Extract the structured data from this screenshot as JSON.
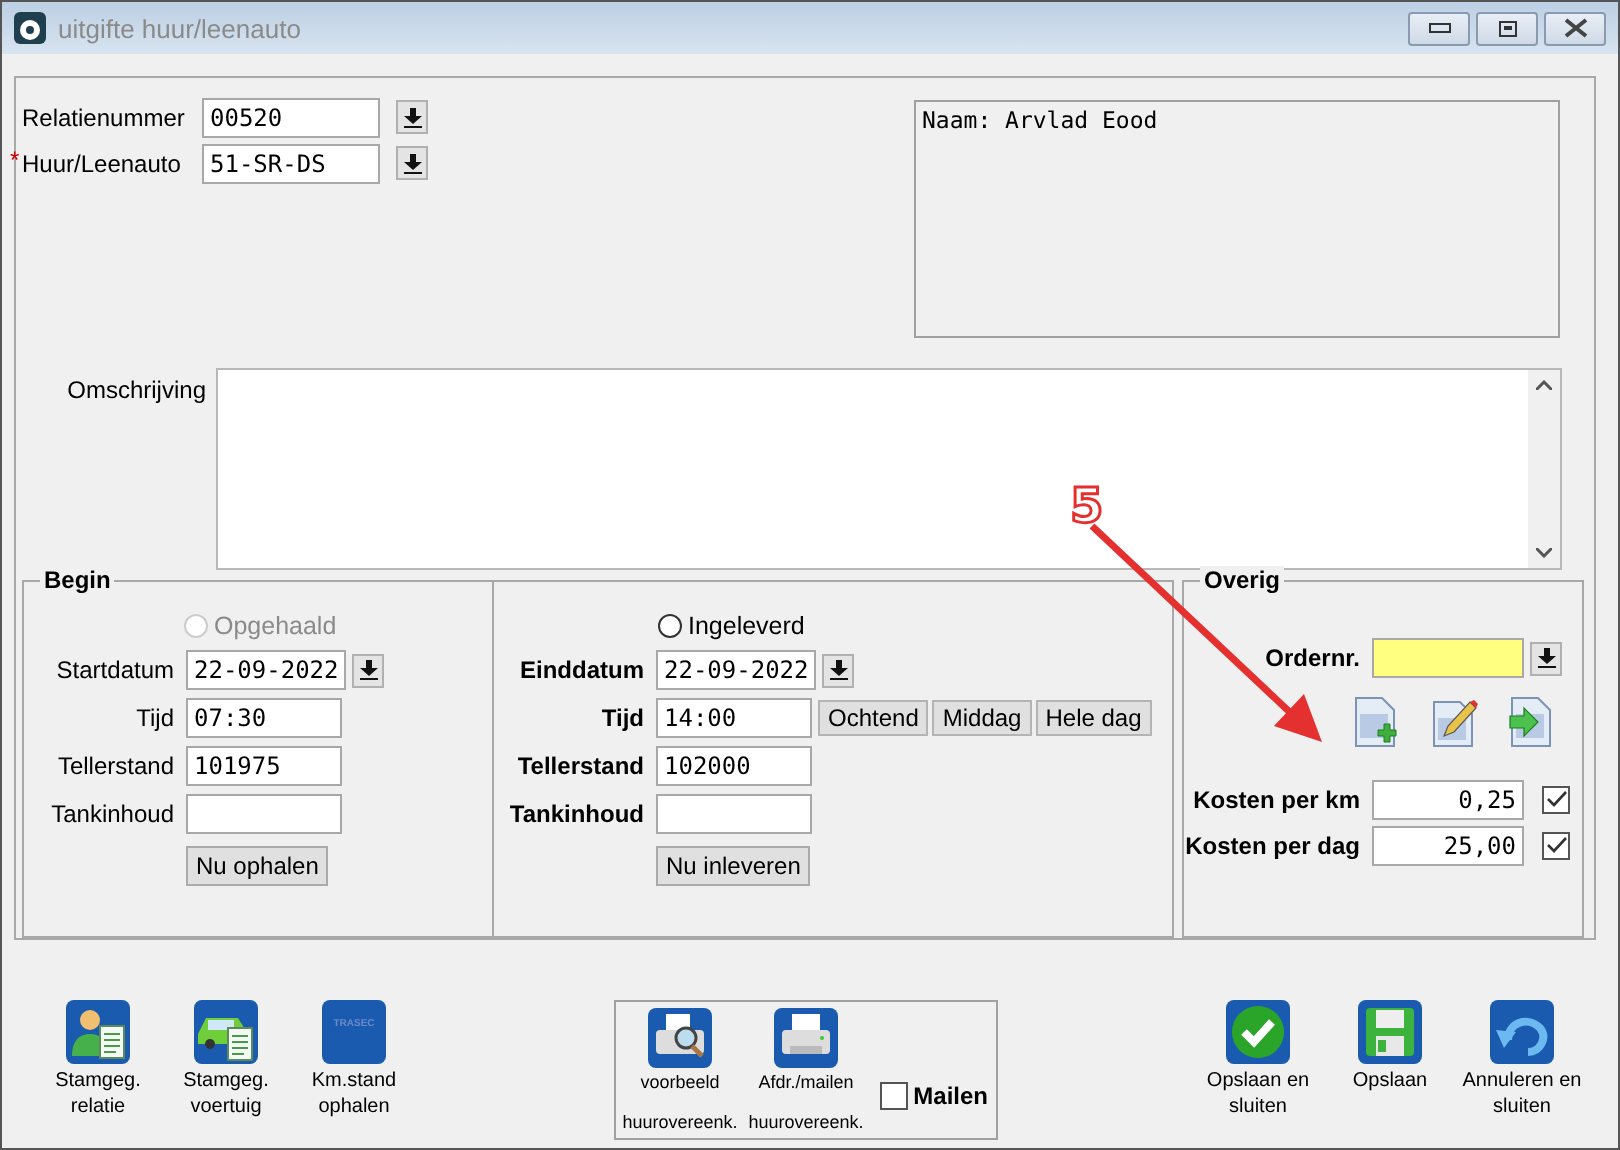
{
  "window": {
    "title": "uitgifte huur/leenauto"
  },
  "header": {
    "fields": [
      {
        "label": "Relatienummer",
        "value": "00520"
      },
      {
        "label": "Huur/Leenauto",
        "value": "51-SR-DS",
        "required_mark": "*"
      }
    ],
    "name_panel": "Naam: Arvlad Eood"
  },
  "description": {
    "label": "Omschrijving"
  },
  "begin": {
    "title": "Begin",
    "radio": {
      "label": "Opgehaald",
      "selected": false,
      "disabled": true
    },
    "fields": [
      {
        "label": "Startdatum",
        "value": "22-09-2022",
        "picker": true
      },
      {
        "label": "Tijd",
        "value": "07:30",
        "picker": false
      },
      {
        "label": "Tellerstand",
        "value": "101975",
        "picker": false
      },
      {
        "label": "Tankinhoud",
        "picker": false
      }
    ],
    "button": "Nu ophalen"
  },
  "end": {
    "radio": {
      "label": "Ingeleverd",
      "selected": false,
      "disabled": false
    },
    "fields": [
      {
        "label": "Einddatum",
        "value": "22-09-2022",
        "picker": true
      },
      {
        "label": "Tijd",
        "value": "14:00",
        "picker": false
      },
      {
        "label": "Tellerstand",
        "value": "102000",
        "picker": false
      },
      {
        "label": "Tankinhoud",
        "picker": false
      }
    ],
    "time_buttons": [
      "Ochtend",
      "Middag",
      "Hele dag"
    ],
    "button": "Nu inleveren"
  },
  "other": {
    "title": "Overig",
    "order_label": "Ordernr.",
    "costs": [
      {
        "label": "Kosten per km",
        "value": "0,25",
        "checked": true
      },
      {
        "label": "Kosten per dag",
        "value": "25,00",
        "checked": true
      }
    ]
  },
  "toolbar_left": [
    {
      "label": "Stamgeg. relatie",
      "kind": "person"
    },
    {
      "label": "Stamgeg. voertuig",
      "kind": "car"
    },
    {
      "label": "Km.stand ophalen",
      "kind": "logo",
      "logo_text": "TRASEC"
    }
  ],
  "print_group": {
    "items": [
      {
        "label": "voorbeeld",
        "sublabel": "huurovereenk.",
        "kind": "preview"
      },
      {
        "label": "Afdr./mailen",
        "sublabel": "huurovereenk.",
        "kind": "print"
      }
    ],
    "mail": {
      "label": "Mailen",
      "checked": false
    }
  },
  "toolbar_right": [
    {
      "label": "Opslaan en sluiten",
      "kind": "ok"
    },
    {
      "label": "Opslaan",
      "kind": "save"
    },
    {
      "label": "Annuleren en sluiten",
      "kind": "undo"
    }
  ],
  "annotation": {
    "label": "5"
  }
}
